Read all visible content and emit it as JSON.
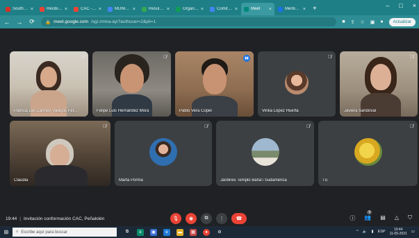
{
  "browser": {
    "tabs": [
      {
        "label": "South Pa",
        "fav_color": "#d93025",
        "active": false
      },
      {
        "label": "Recibidos",
        "fav_color": "#ea4335",
        "active": false
      },
      {
        "label": "CAC - calc",
        "fav_color": "#ea4335",
        "active": false
      },
      {
        "label": "MUNICIPI",
        "fav_color": "#4285f4",
        "active": false
      },
      {
        "label": "Resultado",
        "fav_color": "#34a853",
        "active": false
      },
      {
        "label": "Organizac",
        "fav_color": "#0f9d58",
        "active": false
      },
      {
        "label": "Comité de",
        "fav_color": "#4285f4",
        "active": false
      },
      {
        "label": "Meet",
        "fav_color": "#00897b",
        "active": true
      },
      {
        "label": "Mentime",
        "fav_color": "#1a73e8",
        "active": false
      }
    ],
    "new_tab": "+",
    "window_controls": {
      "minimize": "–",
      "maximize": "□",
      "close": "×"
    },
    "url_host": "meet.google.com",
    "url_path": "/sgi-zmna-ayi?authuser=2&pli=1",
    "update_label": "Actualizar"
  },
  "participants": [
    {
      "name": "Patricia Del Carmen Vallejos Fer...",
      "muted": true,
      "speaking": false
    },
    {
      "name": "Felipe Luis Hernández Mora",
      "muted": true,
      "speaking": false
    },
    {
      "name": "Pablo Vera Coper",
      "muted": false,
      "speaking": true
    },
    {
      "name": "Vinka Lopez Huerta",
      "muted": true,
      "speaking": false
    },
    {
      "name": "Javiera Sandoval",
      "muted": true,
      "speaking": false
    },
    {
      "name": "Claudia",
      "muted": true,
      "speaking": false
    },
    {
      "name": "Marta Porma",
      "muted": true,
      "speaking": false
    },
    {
      "name": "Jardines Templo Bahá'í Sudamérica",
      "muted": true,
      "speaking": false
    },
    {
      "name": "Tú",
      "muted": true,
      "speaking": false
    }
  ],
  "meeting": {
    "time": "19:44",
    "title": "Invitación conformación CAC, Peñalolén",
    "people_count": "9"
  },
  "taskbar": {
    "search_placeholder": "Escribe aquí para buscar",
    "language": "ESP",
    "clock_time": "19:44",
    "clock_date": "11-05-2021"
  },
  "colors": {
    "browser_tabbar": "#1e7f86",
    "meet_background": "#202124",
    "tile_background": "#3c4043",
    "speaking_outline": "#8ab4f8",
    "hangup_red": "#ea4335"
  }
}
